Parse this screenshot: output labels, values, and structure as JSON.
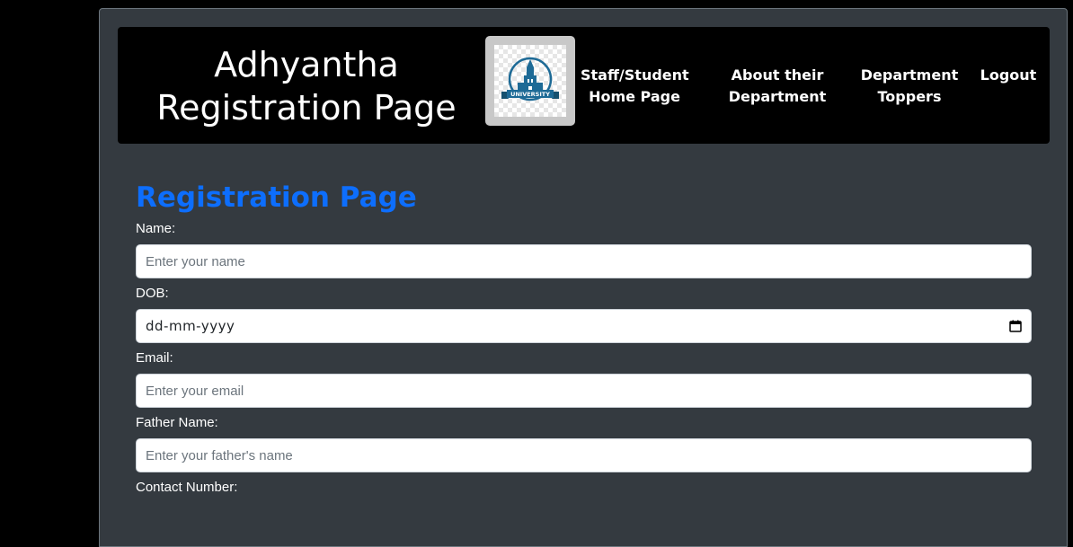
{
  "header": {
    "title_line1": "Adhyantha",
    "title_line2": "Registration Page",
    "logo": {
      "icon": "university-logo-icon",
      "text": "UNIVERSITY",
      "brand_color": "#1d6a96"
    },
    "nav": [
      {
        "line1": "Staff/Student",
        "line2": "Home Page"
      },
      {
        "line1": "About their",
        "line2": "Department"
      },
      {
        "line1": "Department",
        "line2": "Toppers"
      },
      {
        "line1": "Logout",
        "line2": ""
      }
    ]
  },
  "form": {
    "heading": "Registration Page",
    "heading_color": "#0d6efd",
    "fields": {
      "name": {
        "label": "Name:",
        "placeholder": "Enter your name",
        "value": ""
      },
      "dob": {
        "label": "DOB:",
        "placeholder": "dd-mm-yyyy",
        "icon": "calendar-icon"
      },
      "email": {
        "label": "Email:",
        "placeholder": "Enter your email",
        "value": ""
      },
      "father_name": {
        "label": "Father Name:",
        "placeholder": "Enter your father's name",
        "value": ""
      },
      "contact": {
        "label": "Contact Number:"
      }
    }
  },
  "colors": {
    "page_background": "#000000",
    "panel_background": "#343a40",
    "header_background": "#000000"
  }
}
